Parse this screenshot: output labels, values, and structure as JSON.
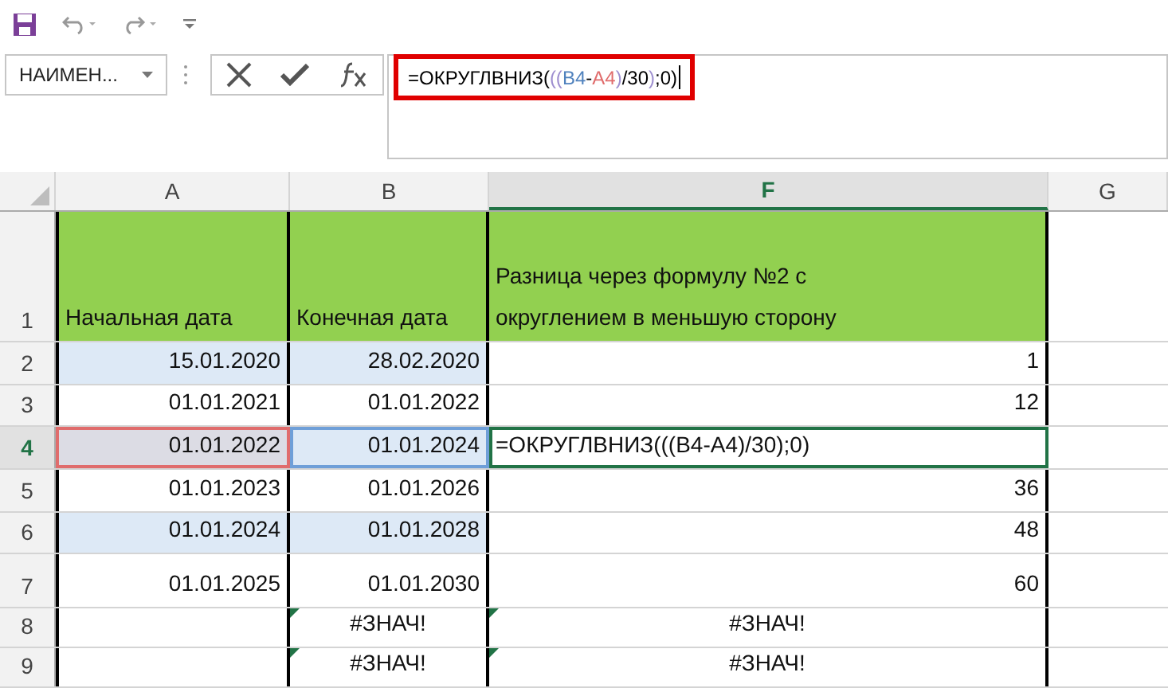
{
  "name_box": {
    "value": "НАИМЕН..."
  },
  "formula_bar": {
    "segments": [
      {
        "text": "=ОКРУГЛВНИЗ(",
        "color": "#000000"
      },
      {
        "text": "((",
        "color": "#9e8fd0"
      },
      {
        "text": "B4",
        "color": "#4f81bd"
      },
      {
        "text": "-",
        "color": "#000000"
      },
      {
        "text": "A4",
        "color": "#e06c6c"
      },
      {
        "text": ")",
        "color": "#9e8fd0"
      },
      {
        "text": "/30",
        "color": "#000000"
      },
      {
        "text": ")",
        "color": "#9e8fd0"
      },
      {
        "text": ";0)",
        "color": "#000000"
      }
    ],
    "highlighted": true
  },
  "columns": [
    {
      "label": "A",
      "selected": false
    },
    {
      "label": "B",
      "selected": false
    },
    {
      "label": "F",
      "selected": true
    },
    {
      "label": "G",
      "selected": false
    }
  ],
  "rows": [
    {
      "number": "1",
      "selected": false,
      "cells": [
        {
          "text": "Начальная дата",
          "kind": "header"
        },
        {
          "text": "Конечная дата",
          "kind": "header"
        },
        {
          "text": "Разница через формулу №2 с округлением в меньшую сторону",
          "kind": "header"
        }
      ]
    },
    {
      "number": "2",
      "selected": false,
      "cells": [
        {
          "text": "15.01.2020",
          "kind": "shaded"
        },
        {
          "text": "28.02.2020",
          "kind": "shaded"
        },
        {
          "text": "1",
          "kind": "plain"
        }
      ]
    },
    {
      "number": "3",
      "selected": false,
      "cells": [
        {
          "text": "01.01.2021",
          "kind": "plain"
        },
        {
          "text": "01.01.2022",
          "kind": "plain"
        },
        {
          "text": "12",
          "kind": "plain"
        }
      ]
    },
    {
      "number": "4",
      "selected": true,
      "cells": [
        {
          "text": "01.01.2022",
          "kind": "ref-red"
        },
        {
          "text": "01.01.2024",
          "kind": "ref-blue"
        },
        {
          "text": "=ОКРУГЛВНИЗ(((B4-A4)/30);0)",
          "kind": "active"
        }
      ]
    },
    {
      "number": "5",
      "selected": false,
      "cells": [
        {
          "text": "01.01.2023",
          "kind": "plain"
        },
        {
          "text": "01.01.2026",
          "kind": "plain"
        },
        {
          "text": "36",
          "kind": "plain"
        }
      ]
    },
    {
      "number": "6",
      "selected": false,
      "cells": [
        {
          "text": "01.01.2024",
          "kind": "shaded"
        },
        {
          "text": "01.01.2028",
          "kind": "shaded"
        },
        {
          "text": "48",
          "kind": "plain"
        }
      ]
    },
    {
      "number": "7",
      "selected": false,
      "cells": [
        {
          "text": "01.01.2025",
          "kind": "plain"
        },
        {
          "text": "01.01.2030",
          "kind": "plain"
        },
        {
          "text": "60",
          "kind": "plain"
        }
      ]
    },
    {
      "number": "8",
      "selected": false,
      "cells": [
        {
          "kind": "plain"
        },
        {
          "text": "#ЗНАЧ!",
          "kind": "flagged"
        },
        {
          "text": "#ЗНАЧ!",
          "kind": "flagged"
        }
      ]
    },
    {
      "number": "9",
      "selected": false,
      "cells": [
        {
          "kind": "plain"
        },
        {
          "text": "#ЗНАЧ!",
          "kind": "flagged"
        },
        {
          "text": "#ЗНАЧ!",
          "kind": "flagged"
        }
      ]
    }
  ]
}
